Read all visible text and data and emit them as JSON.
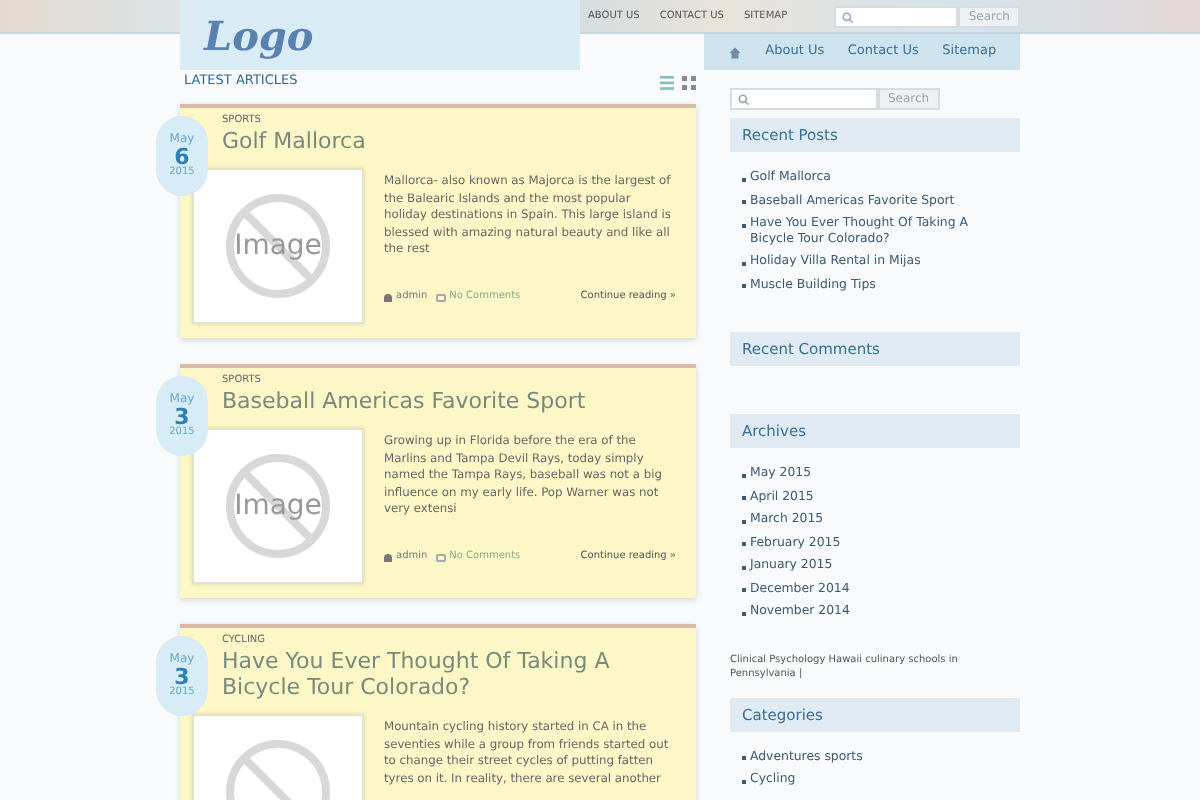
{
  "header": {
    "logo": "Logo",
    "top_nav": [
      "ABOUT US",
      "CONTACT US",
      "SITEMAP"
    ],
    "top_search_button": "Search",
    "main_nav": [
      "About Us",
      "Contact Us",
      "Sitemap"
    ]
  },
  "section_title": "LATEST ARTICLES",
  "articles": [
    {
      "category": "SPORTS",
      "title": "Golf Mallorca",
      "month": "May",
      "day": "6",
      "year": "2015",
      "image_label": "Image",
      "excerpt": "Mallorca- also known as Majorca is the largest of the Balearic Islands and the most popular holiday destinations in Spain. This large island is blessed with amazing natural beauty and like all the rest",
      "author": "admin",
      "comments": "No Comments",
      "more": "Continue reading »"
    },
    {
      "category": "SPORTS",
      "title": "Baseball Americas Favorite Sport",
      "month": "May",
      "day": "3",
      "year": "2015",
      "image_label": "Image",
      "excerpt": "Growing up in Florida before the era of the Marlins and Tampa Devil Rays, today simply named the Tampa Rays, baseball was not a big influence on my early life. Pop Warner was not very extensi",
      "author": "admin",
      "comments": "No Comments",
      "more": "Continue reading »"
    },
    {
      "category": "CYCLING",
      "title": "Have You Ever Thought Of Taking A Bicycle Tour Colorado?",
      "month": "May",
      "day": "3",
      "year": "2015",
      "excerpt": "Mountain cycling history started in CA in the seventies while a group from friends started out to change their street cycles of putting fatten tyres on it. In reality, there are several another"
    }
  ],
  "sidebar": {
    "search_button": "Search",
    "widgets": [
      {
        "kind": "list",
        "title": "Recent Posts",
        "items": [
          "Golf Mallorca",
          "Baseball Americas Favorite Sport",
          "Have You Ever Thought Of Taking A Bicycle Tour Colorado?",
          "Holiday Villa Rental in Mijas",
          "Muscle Building Tips"
        ]
      },
      {
        "kind": "list",
        "title": "Recent Comments"
      },
      {
        "kind": "list",
        "title": "Archives",
        "items": [
          "May 2015",
          "April 2015",
          "March 2015",
          "February 2015",
          "January 2015",
          "December 2014",
          "November 2014"
        ]
      },
      {
        "kind": "text",
        "text": "Clinical Psychology Hawaii culinary schools in Pennsylvania |"
      },
      {
        "kind": "list",
        "title": "Categories",
        "items": [
          "Adventures sports",
          "Cycling"
        ]
      }
    ]
  }
}
